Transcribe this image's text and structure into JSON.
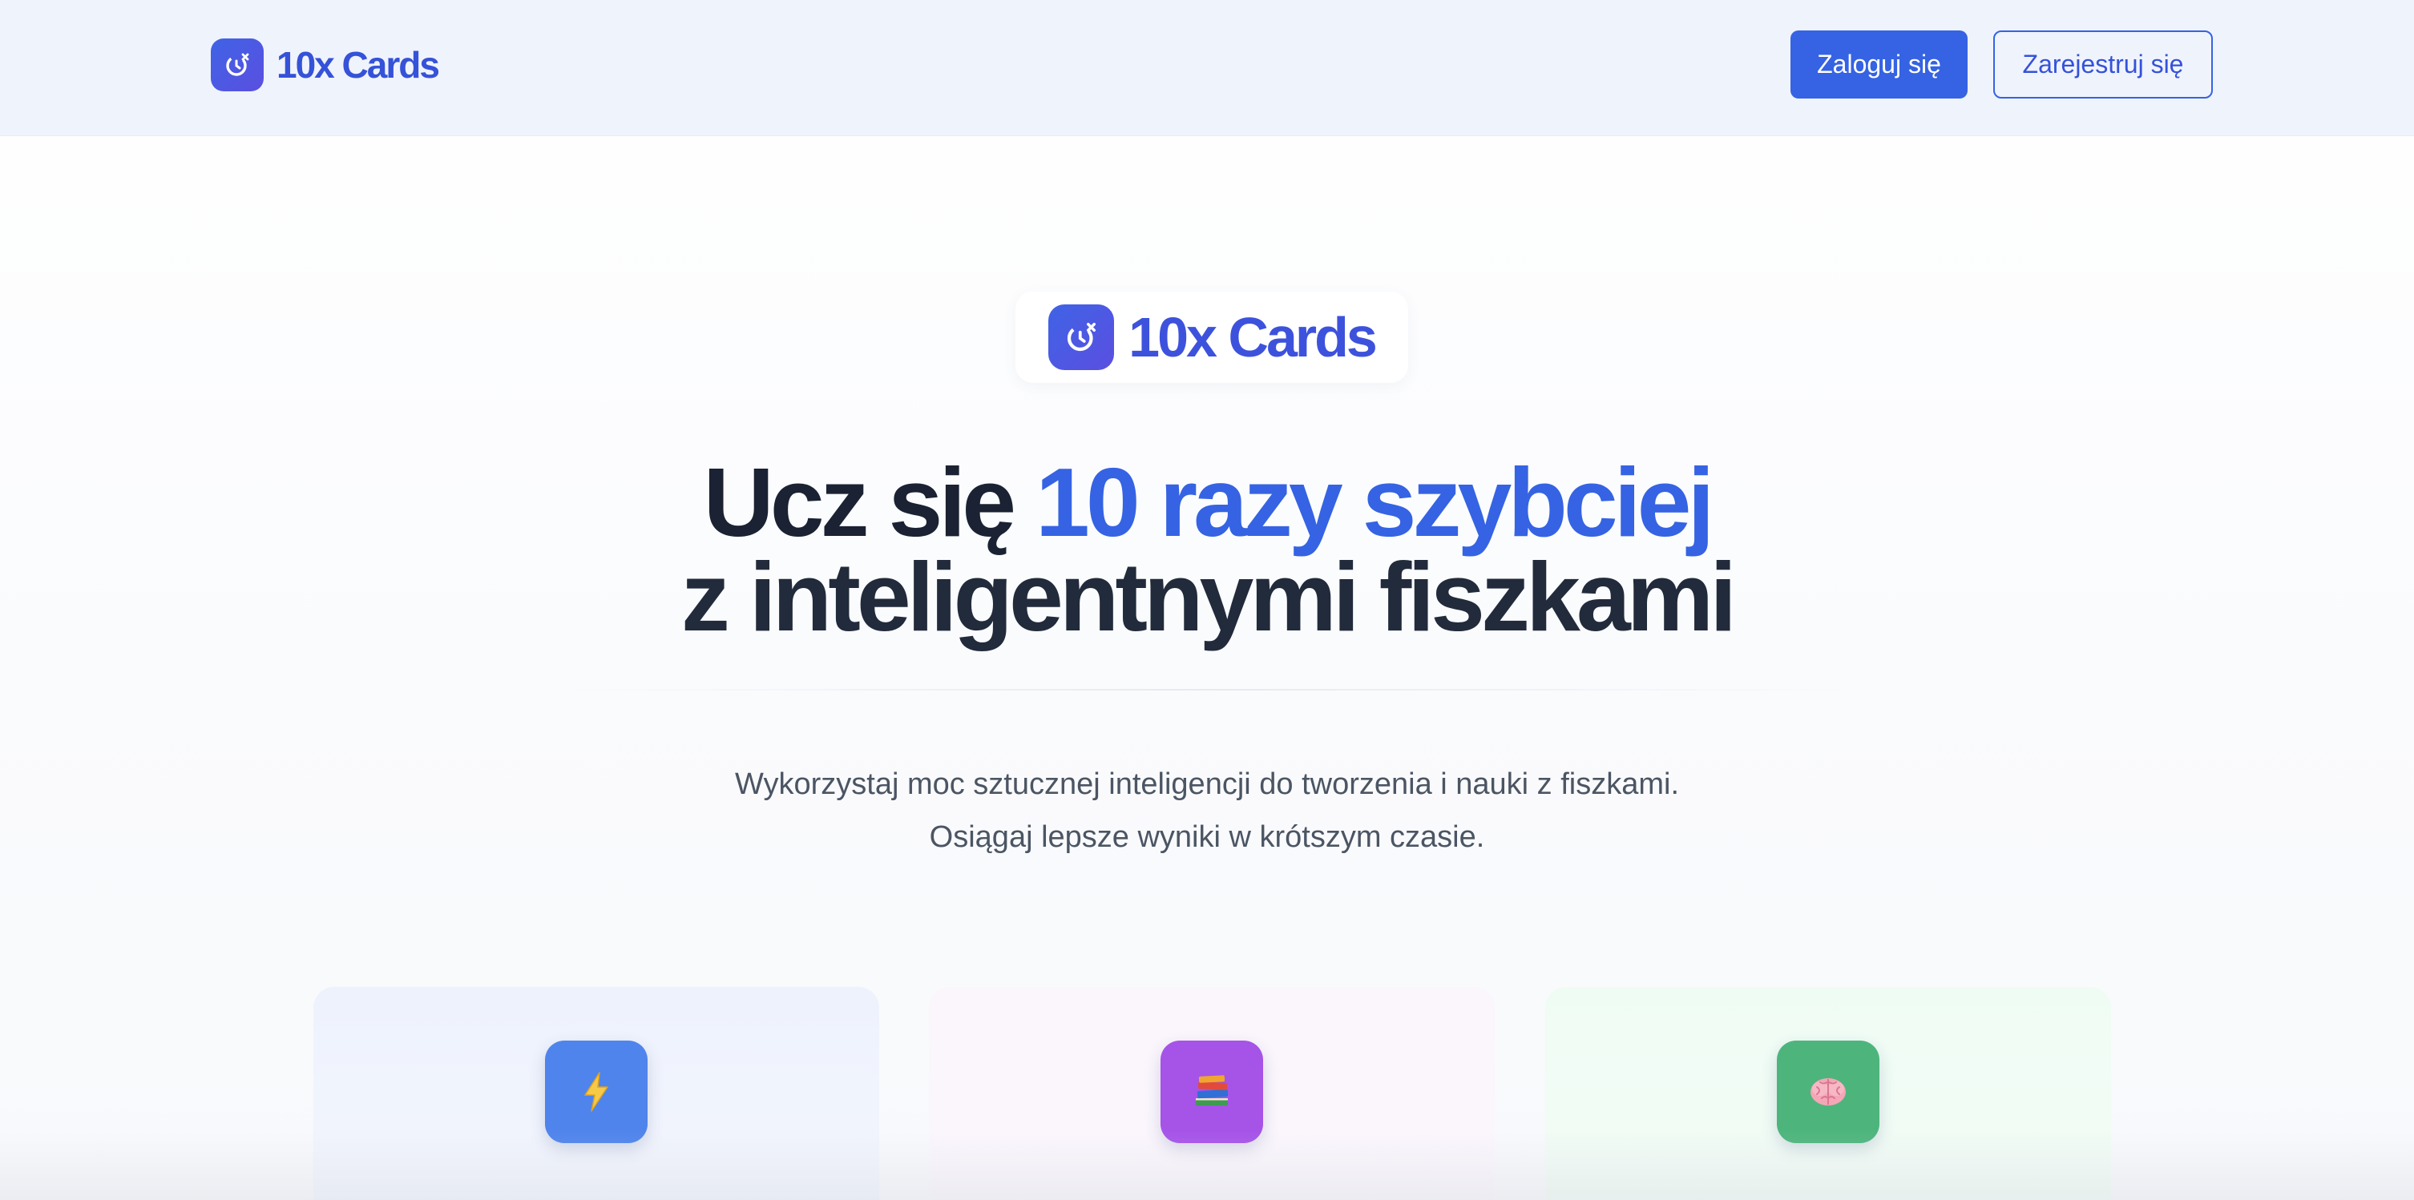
{
  "header": {
    "brand": "10x Cards",
    "login_label": "Zaloguj się",
    "register_label": "Zarejestruj się"
  },
  "hero": {
    "badge_text": "10x Cards",
    "headline_part1": "Ucz się ",
    "headline_accent": "10 razy szybciej",
    "headline_line2": "z inteligentnymi fiszkami",
    "subtitle_line1": "Wykorzystaj moc sztucznej inteligencji do tworzenia i nauki z fiszkami.",
    "subtitle_line2": "Osiągaj lepsze wyniki w krótszym czasie."
  },
  "features": [
    {
      "icon": "lightning-icon",
      "color": "#4f84ec"
    },
    {
      "icon": "books-icon",
      "color": "#a653e8"
    },
    {
      "icon": "brain-icon",
      "color": "#4db57c"
    }
  ],
  "colors": {
    "accent": "#3563e3",
    "brand": "#3552d8",
    "header_bg": "#eff3fc",
    "headline": "#1a2233"
  }
}
